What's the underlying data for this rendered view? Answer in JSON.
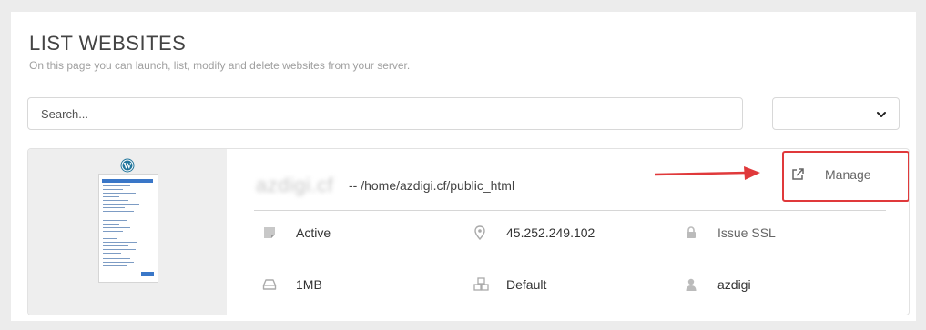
{
  "header": {
    "title": "LIST WEBSITES",
    "subtitle": "On this page you can launch, list, modify and delete websites from your server."
  },
  "search": {
    "placeholder": "Search..."
  },
  "filter": {
    "selected": ""
  },
  "website": {
    "domain": "azdigi.cf",
    "path": "-- /home/azdigi.cf/public_html",
    "manage_label": "Manage",
    "status": "Active",
    "ip": "45.252.249.102",
    "ssl_label": "Issue SSL",
    "disk": "1MB",
    "package": "Default",
    "owner": "azdigi"
  },
  "icons": {
    "status": "status-icon",
    "ip": "map-marker-icon",
    "ssl": "lock-icon",
    "disk": "hard-drive-icon",
    "package": "cubes-icon",
    "owner": "user-icon",
    "manage": "external-link-icon",
    "logo": "wordpress-icon"
  },
  "colors": {
    "highlight": "#e0393b",
    "arrow": "#e0393b"
  }
}
